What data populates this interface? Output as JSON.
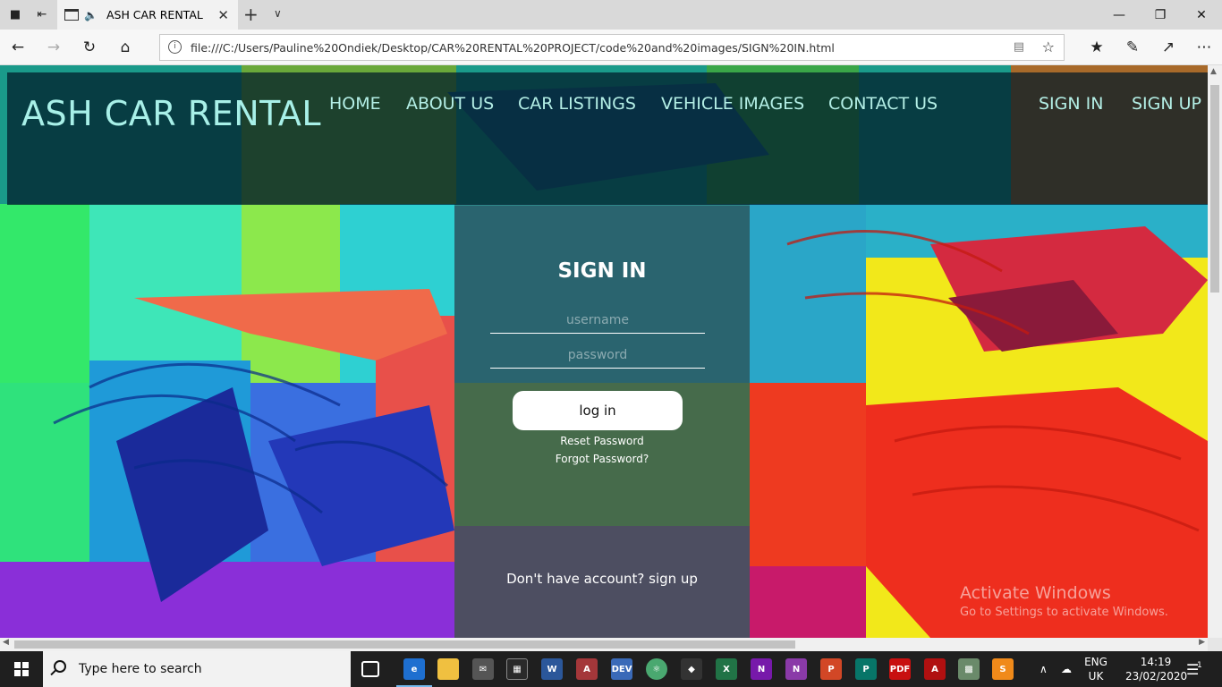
{
  "browser": {
    "tab_title": "ASH CAR RENTAL",
    "url": "file:///C:/Users/Pauline%20Ondiek/Desktop/CAR%20RENTAL%20PROJECT/code%20and%20images/SIGN%20IN.html"
  },
  "site": {
    "logo": "ASH CAR RENTAL",
    "nav": {
      "home": "HOME",
      "about": "ABOUT US",
      "listings": "CAR LISTINGS",
      "images": "VEHICLE IMAGES",
      "contact": "CONTACT US",
      "signin": "SIGN IN",
      "signup": "SIGN UP"
    }
  },
  "signin_form": {
    "title": "SIGN IN",
    "username_placeholder": "username",
    "password_placeholder": "password",
    "login_label": "log in",
    "reset_link": "Reset Password",
    "forgot_link": "Forgot Password?",
    "signup_prompt": "Don't have account? sign up"
  },
  "watermark": {
    "line1": "Activate Windows",
    "line2": "Go to Settings to activate Windows."
  },
  "taskbar": {
    "search_placeholder": "Type here to search",
    "lang_line1": "ENG",
    "lang_line2": "UK",
    "time": "14:19",
    "date": "23/02/2020",
    "notification_count": "1"
  }
}
